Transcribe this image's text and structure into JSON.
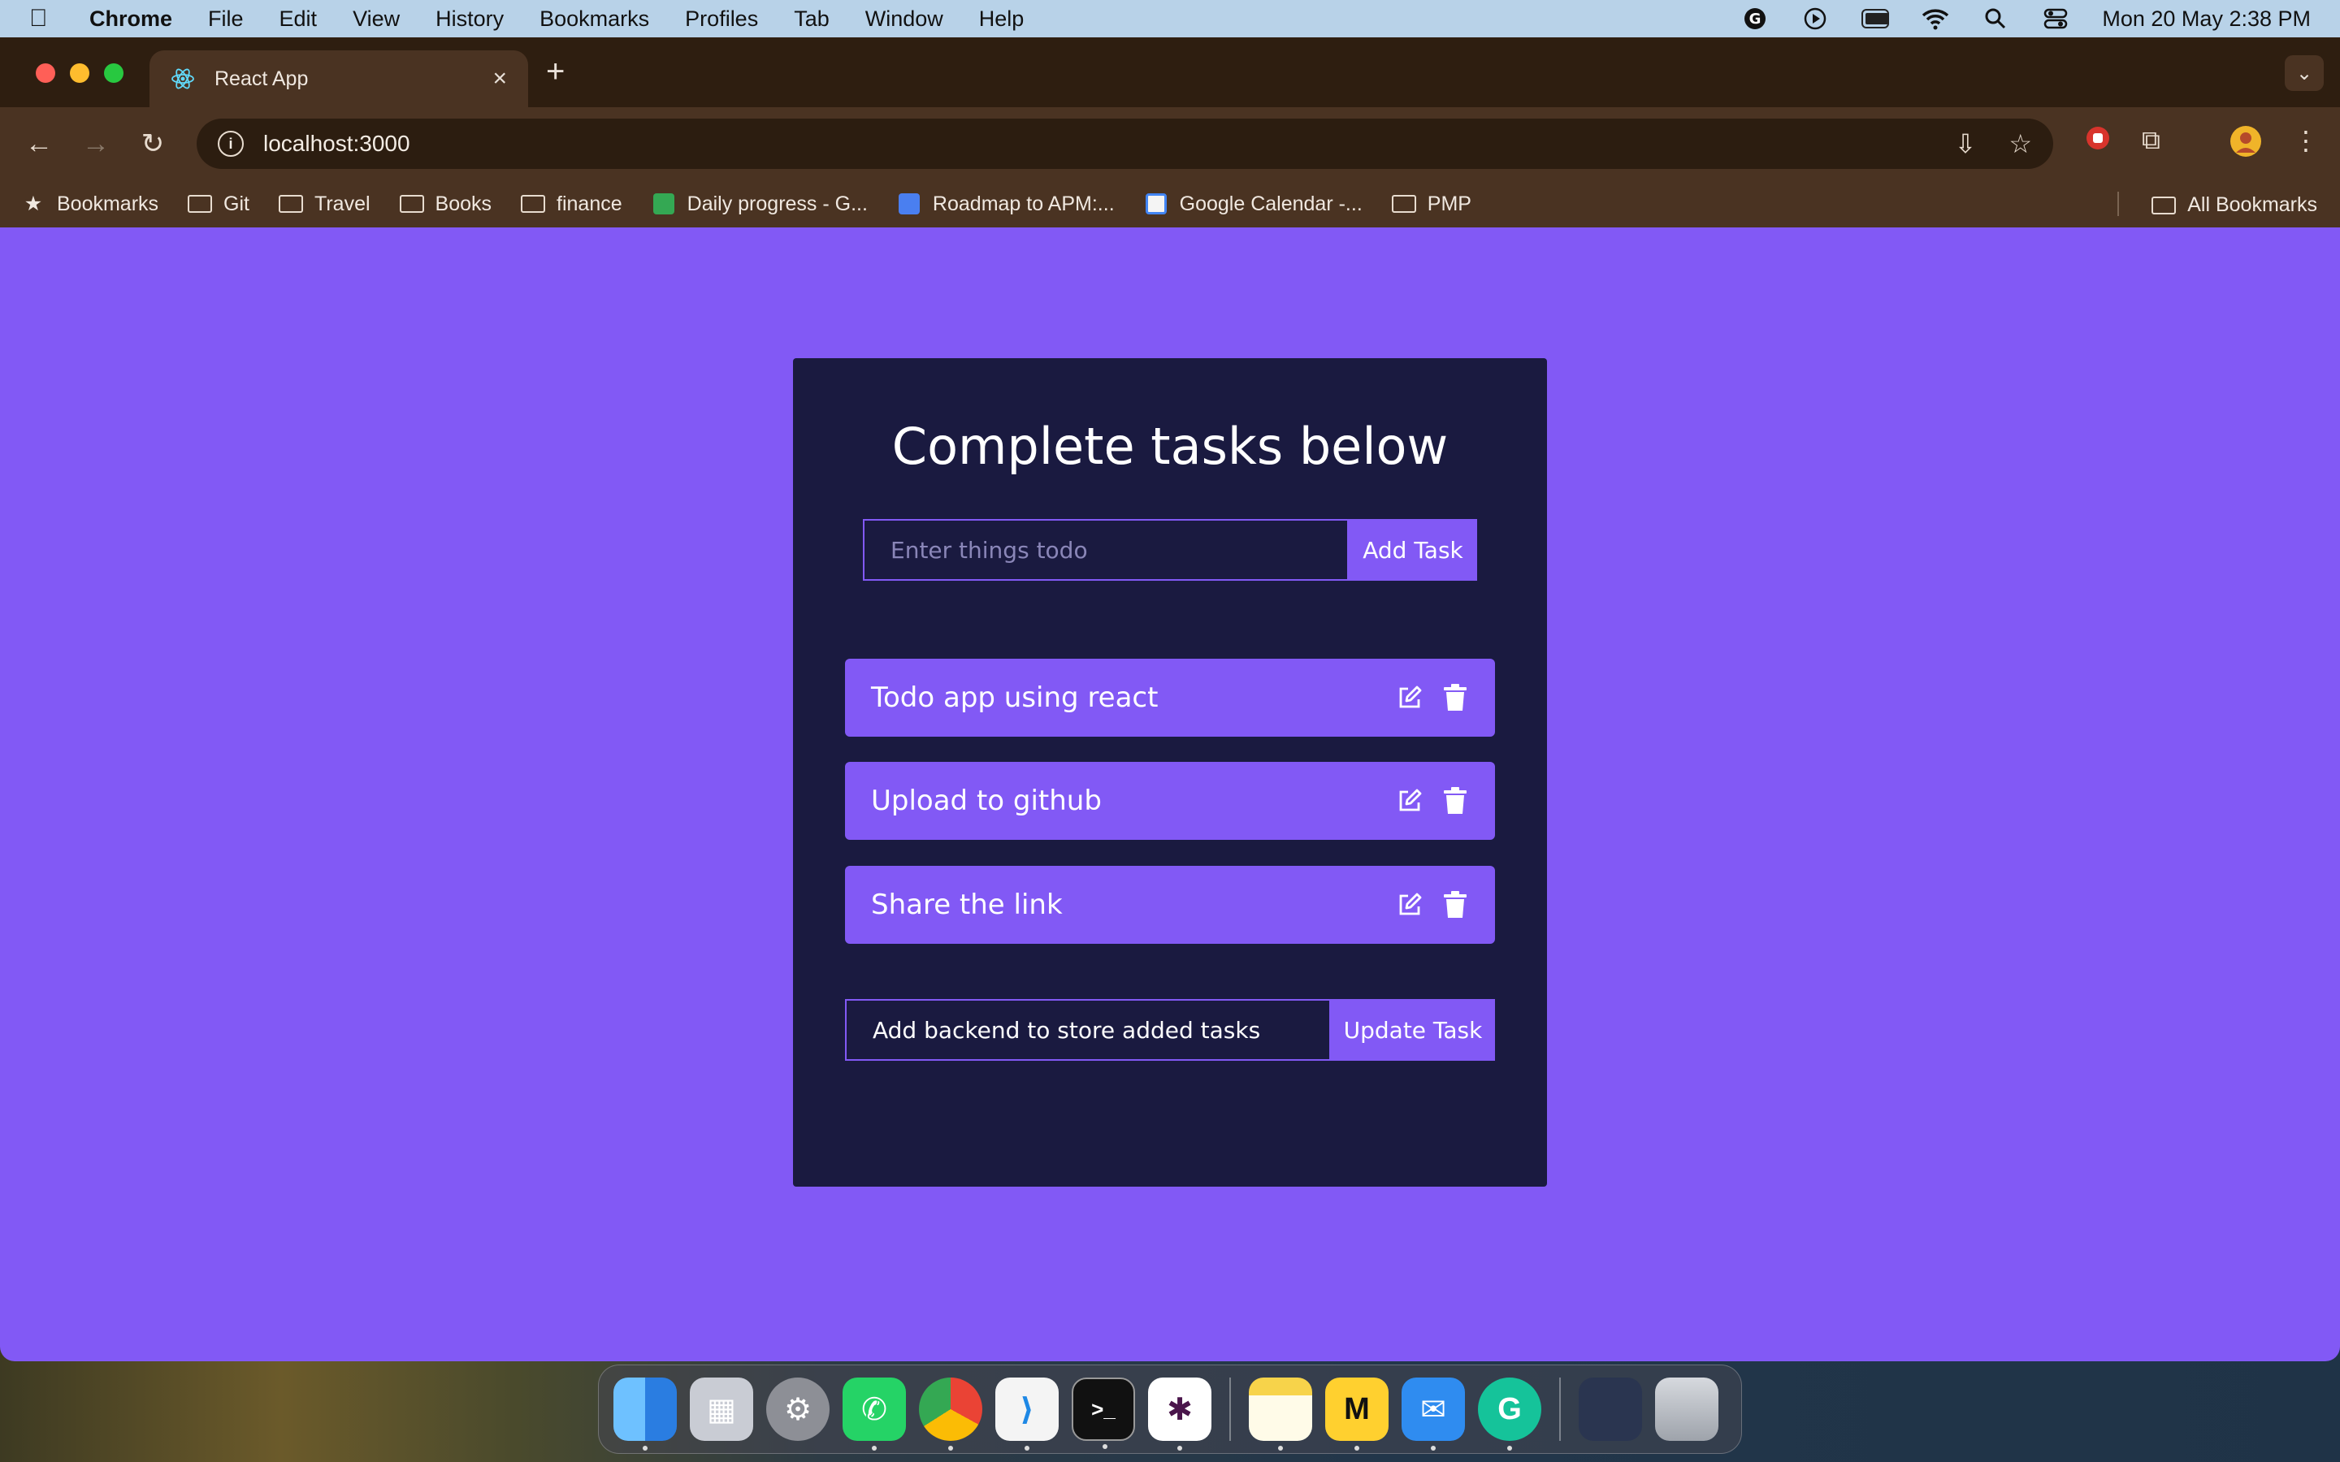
{
  "menubar": {
    "app_name": "Chrome",
    "menus": [
      "File",
      "Edit",
      "View",
      "History",
      "Bookmarks",
      "Profiles",
      "Tab",
      "Window",
      "Help"
    ],
    "datetime": "Mon 20 May  2:38 PM"
  },
  "browser": {
    "tab_title": "React App",
    "url": "localhost:3000",
    "bookmarks": [
      "Bookmarks",
      "Git",
      "Travel",
      "Books",
      "finance",
      "Daily progress - G...",
      "Roadmap to APM:...",
      "Google Calendar -...",
      "PMP"
    ],
    "all_bookmarks": "All Bookmarks"
  },
  "app": {
    "title": "Complete tasks below",
    "add_placeholder": "Enter things todo",
    "add_button": "Add Task",
    "tasks": [
      "Todo app using react",
      "Upload to github",
      "Share the link"
    ],
    "edit_value": "Add backend to store added tasks",
    "update_button": "Update Task"
  },
  "dock": {
    "apps": [
      "finder-icon",
      "launchpad-icon",
      "system-settings-icon",
      "whatsapp-icon",
      "chrome-icon",
      "vscode-icon",
      "terminal-icon",
      "slack-icon",
      "notes-icon",
      "miro-icon",
      "mail-icon",
      "grammarly-icon",
      "screenshot-icon",
      "trash-icon"
    ]
  },
  "colors": {
    "page_bg": "#8259f5",
    "card_bg": "#1a1a40",
    "accent": "#8259f5"
  }
}
